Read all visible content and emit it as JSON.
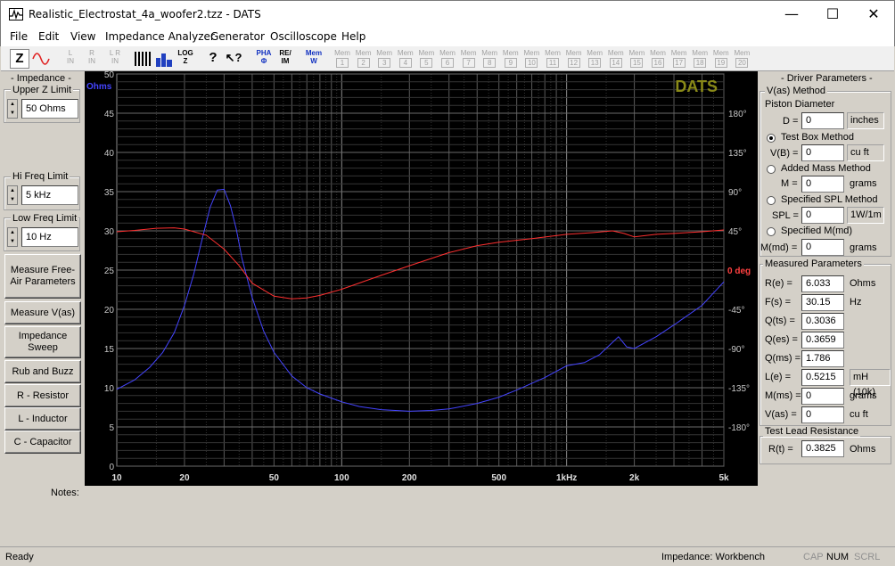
{
  "window": {
    "title": "Realistic_Electrostat_4a_woofer2.tzz - DATS",
    "minimize": "—",
    "maximize": "☐",
    "close": "✕"
  },
  "menu": [
    "File",
    "Edit",
    "View",
    "Impedance Analyzer",
    "Generator",
    "Oscilloscope",
    "Help"
  ],
  "toolbar": {
    "z": "Z",
    "l_in": "L\nIN",
    "r_in": "R\nIN",
    "lr_in": "L R\nIN",
    "log_z": "LOG\nZ",
    "pha": "PHA",
    "re_im": "RE/\nIM",
    "mem_w": "Mem\nW",
    "mem_slots": [
      "1",
      "2",
      "3",
      "4",
      "5",
      "6",
      "7",
      "8",
      "9",
      "10",
      "11",
      "12",
      "13",
      "14",
      "15",
      "16",
      "17",
      "18",
      "19",
      "20"
    ],
    "mem_label": "Mem"
  },
  "left": {
    "impedance_title": "- Impedance -",
    "upper_z_label": "Upper Z Limit",
    "upper_z_value": "50 Ohms",
    "hi_freq_label": "Hi Freq Limit",
    "hi_freq_value": "5 kHz",
    "low_freq_label": "Low Freq Limit",
    "low_freq_value": "10 Hz",
    "buttons": [
      "Measure Free-Air Parameters",
      "Measure V(as)",
      "Impedance Sweep",
      "Rub and Buzz",
      "R - Resistor",
      "L - Inductor",
      "C - Capacitor"
    ]
  },
  "notes_label": "Notes:",
  "chart_data": {
    "type": "line",
    "watermark": "DATS",
    "y_unit_label": "Ohms",
    "y2_unit_label": "0 deg",
    "xscale": "log",
    "xlim": [
      10,
      5000
    ],
    "ylim": [
      0,
      50
    ],
    "y2lim": [
      -225,
      225
    ],
    "grid": true,
    "x_ticks": [
      {
        "v": 10,
        "t": "10"
      },
      {
        "v": 20,
        "t": "20"
      },
      {
        "v": 50,
        "t": "50"
      },
      {
        "v": 100,
        "t": "100"
      },
      {
        "v": 200,
        "t": "200"
      },
      {
        "v": 500,
        "t": "500"
      },
      {
        "v": 1000,
        "t": "1kHz"
      },
      {
        "v": 2000,
        "t": "2k"
      },
      {
        "v": 5000,
        "t": "5k"
      }
    ],
    "y_ticks": [
      "0",
      "5",
      "10",
      "15",
      "20",
      "25",
      "30",
      "35",
      "40",
      "45",
      "50"
    ],
    "y2_ticks": [
      {
        "v": 180,
        "t": "180°"
      },
      {
        "v": 135,
        "t": "135°"
      },
      {
        "v": 90,
        "t": "90°"
      },
      {
        "v": 45,
        "t": "45°"
      },
      {
        "v": -45,
        "t": "-45°"
      },
      {
        "v": -90,
        "t": "-90°"
      },
      {
        "v": -135,
        "t": "-135°"
      },
      {
        "v": -180,
        "t": "-180°"
      }
    ],
    "series": [
      {
        "color": "#4444ff",
        "axis": "y",
        "x": [
          10,
          12,
          14,
          16,
          18,
          20,
          22,
          24,
          26,
          28,
          30,
          32,
          34,
          36,
          40,
          45,
          50,
          60,
          70,
          80,
          100,
          120,
          150,
          200,
          250,
          300,
          400,
          500,
          600,
          800,
          1000,
          1200,
          1400,
          1700,
          1850,
          2000,
          2500,
          3000,
          4000,
          5000
        ],
        "y": [
          9.8,
          11,
          12.6,
          14.5,
          17,
          20.5,
          24.5,
          29,
          33,
          35.2,
          35.3,
          33.2,
          30.2,
          26.5,
          21.5,
          17.2,
          14.5,
          11.5,
          10,
          9.2,
          8.2,
          7.6,
          7.2,
          7.0,
          7.1,
          7.3,
          8.0,
          8.8,
          9.7,
          11.3,
          12.8,
          13.2,
          14.2,
          16.5,
          15.2,
          15.0,
          16.5,
          18,
          20.5,
          23.5
        ]
      },
      {
        "color": "#ff3030",
        "axis": "y2",
        "x": [
          10,
          12,
          15,
          18,
          20,
          25,
          30,
          35,
          40,
          50,
          60,
          70,
          80,
          100,
          150,
          200,
          300,
          400,
          500,
          700,
          1000,
          1300,
          1600,
          1800,
          2000,
          2500,
          3000,
          4000,
          5000
        ],
        "y": [
          44,
          45.5,
          48,
          48.5,
          47,
          40,
          24,
          5,
          -15,
          -30,
          -33,
          -32,
          -29,
          -22,
          -6,
          5,
          20,
          28,
          32,
          36,
          41,
          43,
          45,
          42,
          38,
          41,
          42,
          44,
          46
        ]
      }
    ]
  },
  "right": {
    "title": "- Driver Parameters -",
    "vas_method": "V(as) Method",
    "piston_label": "Piston Diameter",
    "d_label": "D =",
    "d_value": "0",
    "d_unit": "inches",
    "test_box": "Test Box Method",
    "vb_label": "V(B) =",
    "vb_value": "0",
    "vb_unit": "cu ft",
    "added_mass": "Added Mass Method",
    "m_label": "M =",
    "m_value": "0",
    "m_unit": "grams",
    "spl_method": "Specified SPL Method",
    "spl_label": "SPL =",
    "spl_value": "0",
    "spl_unit": "1W/1m",
    "mmd_method": "Specified M(md)",
    "mmd_label": "M(md) =",
    "mmd_value": "0",
    "mmd_unit": "grams",
    "measured_title": "Measured Parameters",
    "measured": [
      {
        "label": "R(e) =",
        "value": "6.033",
        "unit": "Ohms"
      },
      {
        "label": "F(s) =",
        "value": "30.15",
        "unit": "Hz"
      },
      {
        "label": "Q(ts) =",
        "value": "0.3036",
        "unit": ""
      },
      {
        "label": "Q(es) =",
        "value": "0.3659",
        "unit": ""
      },
      {
        "label": "Q(ms) =",
        "value": "1.786",
        "unit": ""
      },
      {
        "label": "L(e) =",
        "value": "0.5215",
        "unit": "mH (10k)"
      },
      {
        "label": "M(ms) =",
        "value": "0",
        "unit": "grams"
      },
      {
        "label": "V(as) =",
        "value": "0",
        "unit": "cu ft"
      }
    ],
    "lead_title": "Test Lead Resistance",
    "rt_label": "R(t) =",
    "rt_value": "0.3825",
    "rt_unit": "Ohms"
  },
  "status": {
    "ready": "Ready",
    "mode": "Impedance: Workbench",
    "cap": "CAP",
    "num": "NUM",
    "scrl": "SCRL"
  }
}
